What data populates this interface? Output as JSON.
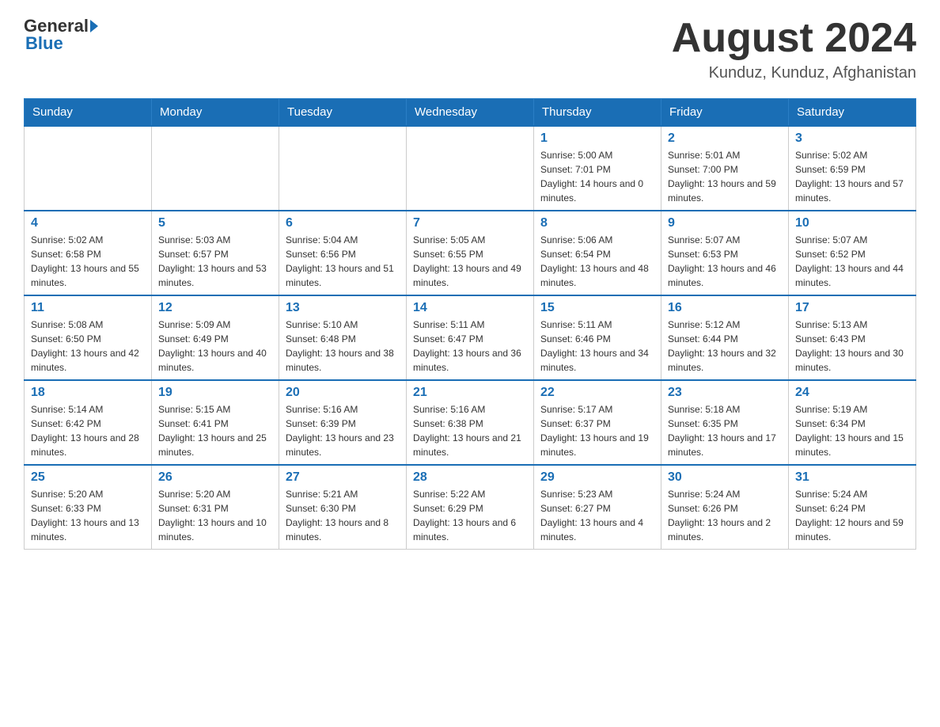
{
  "header": {
    "logo_general": "General",
    "logo_blue": "Blue",
    "month_year": "August 2024",
    "location": "Kunduz, Kunduz, Afghanistan"
  },
  "weekdays": [
    "Sunday",
    "Monday",
    "Tuesday",
    "Wednesday",
    "Thursday",
    "Friday",
    "Saturday"
  ],
  "weeks": [
    [
      {
        "day": "",
        "sunrise": "",
        "sunset": "",
        "daylight": ""
      },
      {
        "day": "",
        "sunrise": "",
        "sunset": "",
        "daylight": ""
      },
      {
        "day": "",
        "sunrise": "",
        "sunset": "",
        "daylight": ""
      },
      {
        "day": "",
        "sunrise": "",
        "sunset": "",
        "daylight": ""
      },
      {
        "day": "1",
        "sunrise": "Sunrise: 5:00 AM",
        "sunset": "Sunset: 7:01 PM",
        "daylight": "Daylight: 14 hours and 0 minutes."
      },
      {
        "day": "2",
        "sunrise": "Sunrise: 5:01 AM",
        "sunset": "Sunset: 7:00 PM",
        "daylight": "Daylight: 13 hours and 59 minutes."
      },
      {
        "day": "3",
        "sunrise": "Sunrise: 5:02 AM",
        "sunset": "Sunset: 6:59 PM",
        "daylight": "Daylight: 13 hours and 57 minutes."
      }
    ],
    [
      {
        "day": "4",
        "sunrise": "Sunrise: 5:02 AM",
        "sunset": "Sunset: 6:58 PM",
        "daylight": "Daylight: 13 hours and 55 minutes."
      },
      {
        "day": "5",
        "sunrise": "Sunrise: 5:03 AM",
        "sunset": "Sunset: 6:57 PM",
        "daylight": "Daylight: 13 hours and 53 minutes."
      },
      {
        "day": "6",
        "sunrise": "Sunrise: 5:04 AM",
        "sunset": "Sunset: 6:56 PM",
        "daylight": "Daylight: 13 hours and 51 minutes."
      },
      {
        "day": "7",
        "sunrise": "Sunrise: 5:05 AM",
        "sunset": "Sunset: 6:55 PM",
        "daylight": "Daylight: 13 hours and 49 minutes."
      },
      {
        "day": "8",
        "sunrise": "Sunrise: 5:06 AM",
        "sunset": "Sunset: 6:54 PM",
        "daylight": "Daylight: 13 hours and 48 minutes."
      },
      {
        "day": "9",
        "sunrise": "Sunrise: 5:07 AM",
        "sunset": "Sunset: 6:53 PM",
        "daylight": "Daylight: 13 hours and 46 minutes."
      },
      {
        "day": "10",
        "sunrise": "Sunrise: 5:07 AM",
        "sunset": "Sunset: 6:52 PM",
        "daylight": "Daylight: 13 hours and 44 minutes."
      }
    ],
    [
      {
        "day": "11",
        "sunrise": "Sunrise: 5:08 AM",
        "sunset": "Sunset: 6:50 PM",
        "daylight": "Daylight: 13 hours and 42 minutes."
      },
      {
        "day": "12",
        "sunrise": "Sunrise: 5:09 AM",
        "sunset": "Sunset: 6:49 PM",
        "daylight": "Daylight: 13 hours and 40 minutes."
      },
      {
        "day": "13",
        "sunrise": "Sunrise: 5:10 AM",
        "sunset": "Sunset: 6:48 PM",
        "daylight": "Daylight: 13 hours and 38 minutes."
      },
      {
        "day": "14",
        "sunrise": "Sunrise: 5:11 AM",
        "sunset": "Sunset: 6:47 PM",
        "daylight": "Daylight: 13 hours and 36 minutes."
      },
      {
        "day": "15",
        "sunrise": "Sunrise: 5:11 AM",
        "sunset": "Sunset: 6:46 PM",
        "daylight": "Daylight: 13 hours and 34 minutes."
      },
      {
        "day": "16",
        "sunrise": "Sunrise: 5:12 AM",
        "sunset": "Sunset: 6:44 PM",
        "daylight": "Daylight: 13 hours and 32 minutes."
      },
      {
        "day": "17",
        "sunrise": "Sunrise: 5:13 AM",
        "sunset": "Sunset: 6:43 PM",
        "daylight": "Daylight: 13 hours and 30 minutes."
      }
    ],
    [
      {
        "day": "18",
        "sunrise": "Sunrise: 5:14 AM",
        "sunset": "Sunset: 6:42 PM",
        "daylight": "Daylight: 13 hours and 28 minutes."
      },
      {
        "day": "19",
        "sunrise": "Sunrise: 5:15 AM",
        "sunset": "Sunset: 6:41 PM",
        "daylight": "Daylight: 13 hours and 25 minutes."
      },
      {
        "day": "20",
        "sunrise": "Sunrise: 5:16 AM",
        "sunset": "Sunset: 6:39 PM",
        "daylight": "Daylight: 13 hours and 23 minutes."
      },
      {
        "day": "21",
        "sunrise": "Sunrise: 5:16 AM",
        "sunset": "Sunset: 6:38 PM",
        "daylight": "Daylight: 13 hours and 21 minutes."
      },
      {
        "day": "22",
        "sunrise": "Sunrise: 5:17 AM",
        "sunset": "Sunset: 6:37 PM",
        "daylight": "Daylight: 13 hours and 19 minutes."
      },
      {
        "day": "23",
        "sunrise": "Sunrise: 5:18 AM",
        "sunset": "Sunset: 6:35 PM",
        "daylight": "Daylight: 13 hours and 17 minutes."
      },
      {
        "day": "24",
        "sunrise": "Sunrise: 5:19 AM",
        "sunset": "Sunset: 6:34 PM",
        "daylight": "Daylight: 13 hours and 15 minutes."
      }
    ],
    [
      {
        "day": "25",
        "sunrise": "Sunrise: 5:20 AM",
        "sunset": "Sunset: 6:33 PM",
        "daylight": "Daylight: 13 hours and 13 minutes."
      },
      {
        "day": "26",
        "sunrise": "Sunrise: 5:20 AM",
        "sunset": "Sunset: 6:31 PM",
        "daylight": "Daylight: 13 hours and 10 minutes."
      },
      {
        "day": "27",
        "sunrise": "Sunrise: 5:21 AM",
        "sunset": "Sunset: 6:30 PM",
        "daylight": "Daylight: 13 hours and 8 minutes."
      },
      {
        "day": "28",
        "sunrise": "Sunrise: 5:22 AM",
        "sunset": "Sunset: 6:29 PM",
        "daylight": "Daylight: 13 hours and 6 minutes."
      },
      {
        "day": "29",
        "sunrise": "Sunrise: 5:23 AM",
        "sunset": "Sunset: 6:27 PM",
        "daylight": "Daylight: 13 hours and 4 minutes."
      },
      {
        "day": "30",
        "sunrise": "Sunrise: 5:24 AM",
        "sunset": "Sunset: 6:26 PM",
        "daylight": "Daylight: 13 hours and 2 minutes."
      },
      {
        "day": "31",
        "sunrise": "Sunrise: 5:24 AM",
        "sunset": "Sunset: 6:24 PM",
        "daylight": "Daylight: 12 hours and 59 minutes."
      }
    ]
  ]
}
